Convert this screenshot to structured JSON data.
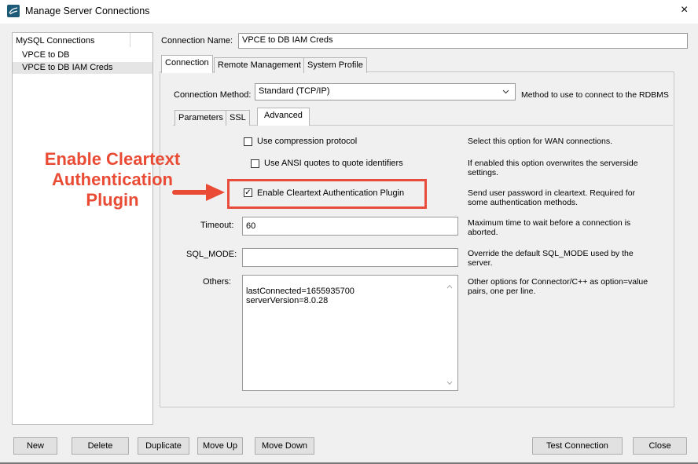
{
  "window": {
    "title": "Manage Server Connections",
    "close_glyph": "×"
  },
  "sidebar": {
    "header": "MySQL Connections",
    "items": [
      {
        "label": "VPCE to DB"
      },
      {
        "label": "VPCE to DB IAM Creds",
        "selected": true
      }
    ]
  },
  "connection_name": {
    "label": "Connection Name:",
    "value": "VPCE to DB IAM Creds"
  },
  "main_tabs": [
    {
      "label": "Connection",
      "selected": true
    },
    {
      "label": "Remote Management"
    },
    {
      "label": "System Profile"
    }
  ],
  "method": {
    "label": "Connection Method:",
    "value": "Standard (TCP/IP)",
    "help": "Method to use to connect to the RDBMS"
  },
  "sub_tabs": [
    {
      "label": "Parameters"
    },
    {
      "label": "SSL"
    },
    {
      "label": "Advanced",
      "selected": true
    }
  ],
  "advanced": {
    "compression": {
      "label": "Use compression protocol",
      "checked": false,
      "help": "Select this option for WAN connections."
    },
    "ansi": {
      "label": "Use ANSI quotes to quote identifiers",
      "checked": false,
      "help": "If enabled this option overwrites the serverside settings."
    },
    "cleartext": {
      "label": "Enable Cleartext Authentication Plugin",
      "checked": true,
      "check_glyph": "✓",
      "help": "Send user password in cleartext. Required for some authentication methods."
    },
    "timeout": {
      "label": "Timeout:",
      "value": "60",
      "help": "Maximum time to wait before a connection is aborted."
    },
    "sql_mode": {
      "label": "SQL_MODE:",
      "value": "",
      "help": "Override the default SQL_MODE used by the server."
    },
    "others": {
      "label": "Others:",
      "value": "lastConnected=1655935700\nserverVersion=8.0.28",
      "help": "Other options for Connector/C++ as option=value pairs, one per line."
    }
  },
  "annotation": {
    "line1": "Enable Cleartext",
    "line2": "Authentication",
    "line3": "Plugin",
    "color": "#e94b35"
  },
  "buttons": {
    "new": "New",
    "delete": "Delete",
    "duplicate": "Duplicate",
    "move_up": "Move Up",
    "move_down": "Move Down",
    "test": "Test Connection",
    "close": "Close"
  }
}
